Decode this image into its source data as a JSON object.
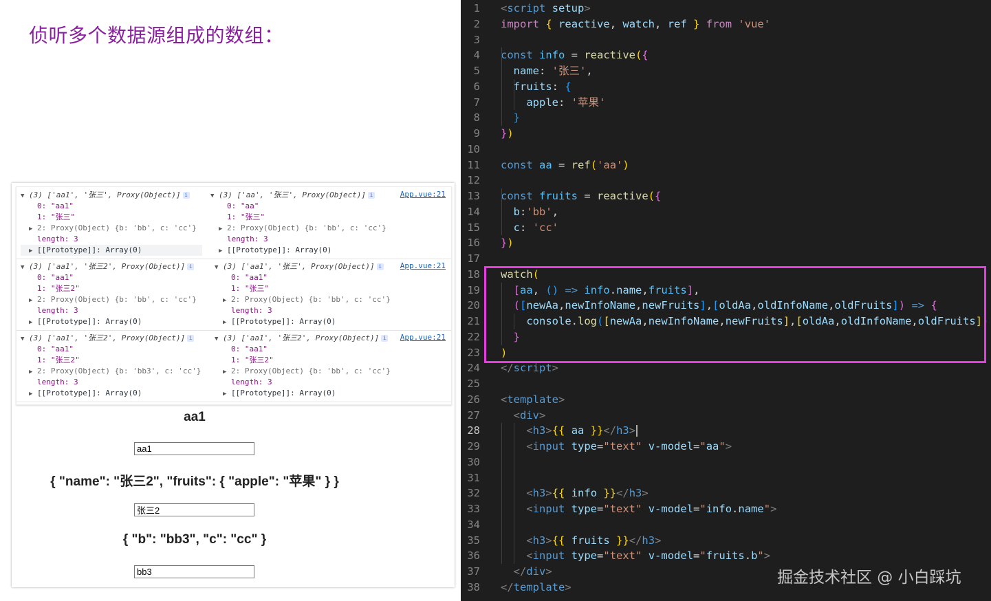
{
  "slide": {
    "title": "侦听多个数据源组成的数组："
  },
  "console": {
    "logs": [
      {
        "source": "App.vue:21",
        "columns": [
          {
            "summary": "(3) ['aa1', '张三', Proxy(Object)]",
            "i0": "0: \"aa1\"",
            "i1": "1: \"张三\"",
            "i2": "2: Proxy(Object) {b: 'bb', c: 'cc'}",
            "length": "length: 3",
            "proto": "[[Prototype]]: Array(0)"
          },
          {
            "summary": "(3) ['aa', '张三', Proxy(Object)]",
            "i0": "0: \"aa\"",
            "i1": "1: \"张三\"",
            "i2": "2: Proxy(Object) {b: 'bb', c: 'cc'}",
            "length": "length: 3",
            "proto": "[[Prototype]]: Array(0)"
          }
        ]
      },
      {
        "source": "App.vue:21",
        "columns": [
          {
            "summary": "(3) ['aa1', '张三2', Proxy(Object)]",
            "i0": "0: \"aa1\"",
            "i1": "1: \"张三2\"",
            "i2": "2: Proxy(Object) {b: 'bb', c: 'cc'}",
            "length": "length: 3",
            "proto": "[[Prototype]]: Array(0)"
          },
          {
            "summary": "(3) ['aa1', '张三', Proxy(Object)]",
            "i0": "0: \"aa1\"",
            "i1": "1: \"张三\"",
            "i2": "2: Proxy(Object) {b: 'bb', c: 'cc'}",
            "length": "length: 3",
            "proto": "[[Prototype]]: Array(0)"
          }
        ]
      },
      {
        "source": "App.vue:21",
        "columns": [
          {
            "summary": "(3) ['aa1', '张三2', Proxy(Object)]",
            "i0": "0: \"aa1\"",
            "i1": "1: \"张三2\"",
            "i2": "2: Proxy(Object) {b: 'bb3', c: 'cc'}",
            "length": "length: 3",
            "proto": "[[Prototype]]: Array(0)"
          },
          {
            "summary": "(3) ['aa1', '张三2', Proxy(Object)]",
            "i0": "0: \"aa1\"",
            "i1": "1: \"张三2\"",
            "i2": "2: Proxy(Object) {b: 'bb', c: 'cc'}",
            "length": "length: 3",
            "proto": "[[Prototype]]: Array(0)"
          }
        ]
      }
    ]
  },
  "preview": {
    "h3_aa": "aa1",
    "input_aa": "aa1",
    "h3_info": "{ \"name\": \"张三2\", \"fruits\": { \"apple\": \"苹果\" } }",
    "input_info": "张三2",
    "h3_fruits": "{ \"b\": \"bb3\", \"c\": \"cc\" }",
    "input_fruits": "bb3"
  },
  "editor": {
    "active_line": 28,
    "lines": [
      [
        [
          "tg",
          "<"
        ],
        [
          "kw",
          "script"
        ],
        [
          "pl",
          " "
        ],
        [
          "prop",
          "setup"
        ],
        [
          "tg",
          ">"
        ]
      ],
      [
        [
          "cd",
          "import"
        ],
        [
          "pl",
          " "
        ],
        [
          "br1",
          "{"
        ],
        [
          "pl",
          " "
        ],
        [
          "prop",
          "reactive"
        ],
        [
          "pl",
          ", "
        ],
        [
          "prop",
          "watch"
        ],
        [
          "pl",
          ", "
        ],
        [
          "prop",
          "ref"
        ],
        [
          "pl",
          " "
        ],
        [
          "br1",
          "}"
        ],
        [
          "pl",
          " "
        ],
        [
          "cd",
          "from"
        ],
        [
          "pl",
          " "
        ],
        [
          "str",
          "'vue'"
        ]
      ],
      [],
      [
        [
          "kw",
          "const"
        ],
        [
          "pl",
          " "
        ],
        [
          "var",
          "info"
        ],
        [
          "pl",
          " = "
        ],
        [
          "fn",
          "reactive"
        ],
        [
          "br1",
          "("
        ],
        [
          "br2",
          "{"
        ]
      ],
      [
        [
          "pl",
          "  "
        ],
        [
          "prop",
          "name"
        ],
        [
          "pl",
          ": "
        ],
        [
          "str",
          "'张三'"
        ],
        [
          "pl",
          ","
        ]
      ],
      [
        [
          "pl",
          "  "
        ],
        [
          "prop",
          "fruits"
        ],
        [
          "pl",
          ": "
        ],
        [
          "br3",
          "{"
        ]
      ],
      [
        [
          "pl",
          "    "
        ],
        [
          "prop",
          "apple"
        ],
        [
          "pl",
          ": "
        ],
        [
          "str",
          "'苹果'"
        ]
      ],
      [
        [
          "pl",
          "  "
        ],
        [
          "br3",
          "}"
        ]
      ],
      [
        [
          "br2",
          "}"
        ],
        [
          "br1",
          ")"
        ]
      ],
      [],
      [
        [
          "kw",
          "const"
        ],
        [
          "pl",
          " "
        ],
        [
          "var",
          "aa"
        ],
        [
          "pl",
          " = "
        ],
        [
          "fn",
          "ref"
        ],
        [
          "br1",
          "("
        ],
        [
          "str",
          "'aa'"
        ],
        [
          "br1",
          ")"
        ]
      ],
      [],
      [
        [
          "kw",
          "const"
        ],
        [
          "pl",
          " "
        ],
        [
          "var",
          "fruits"
        ],
        [
          "pl",
          " = "
        ],
        [
          "fn",
          "reactive"
        ],
        [
          "br1",
          "("
        ],
        [
          "br2",
          "{"
        ]
      ],
      [
        [
          "pl",
          "  "
        ],
        [
          "prop",
          "b"
        ],
        [
          "pl",
          ":"
        ],
        [
          "str",
          "'bb'"
        ],
        [
          "pl",
          ","
        ]
      ],
      [
        [
          "pl",
          "  "
        ],
        [
          "prop",
          "c"
        ],
        [
          "pl",
          ": "
        ],
        [
          "str",
          "'cc'"
        ]
      ],
      [
        [
          "br2",
          "}"
        ],
        [
          "br1",
          ")"
        ]
      ],
      [],
      [
        [
          "fn",
          "watch"
        ],
        [
          "br1",
          "("
        ]
      ],
      [
        [
          "pl",
          "  "
        ],
        [
          "br2",
          "["
        ],
        [
          "var",
          "aa"
        ],
        [
          "pl",
          ", "
        ],
        [
          "br3",
          "()"
        ],
        [
          "pl",
          " "
        ],
        [
          "kw",
          "=>"
        ],
        [
          "pl",
          " "
        ],
        [
          "var",
          "info"
        ],
        [
          "pl",
          "."
        ],
        [
          "prop",
          "name"
        ],
        [
          "pl",
          ","
        ],
        [
          "var",
          "fruits"
        ],
        [
          "br2",
          "]"
        ],
        [
          "pl",
          ","
        ]
      ],
      [
        [
          "pl",
          "  "
        ],
        [
          "br2",
          "("
        ],
        [
          "br3",
          "["
        ],
        [
          "prop",
          "newAa"
        ],
        [
          "pl",
          ","
        ],
        [
          "prop",
          "newInfoName"
        ],
        [
          "pl",
          ","
        ],
        [
          "prop",
          "newFruits"
        ],
        [
          "br3",
          "]"
        ],
        [
          "pl",
          ","
        ],
        [
          "br3",
          "["
        ],
        [
          "prop",
          "oldAa"
        ],
        [
          "pl",
          ","
        ],
        [
          "prop",
          "oldInfoName"
        ],
        [
          "pl",
          ","
        ],
        [
          "prop",
          "oldFruits"
        ],
        [
          "br3",
          "]"
        ],
        [
          "br2",
          ")"
        ],
        [
          "pl",
          " "
        ],
        [
          "kw",
          "=>"
        ],
        [
          "pl",
          " "
        ],
        [
          "br2",
          "{"
        ]
      ],
      [
        [
          "pl",
          "    "
        ],
        [
          "prop",
          "console"
        ],
        [
          "pl",
          "."
        ],
        [
          "fn",
          "log"
        ],
        [
          "br3",
          "("
        ],
        [
          "br1",
          "["
        ],
        [
          "prop",
          "newAa"
        ],
        [
          "pl",
          ","
        ],
        [
          "prop",
          "newInfoName"
        ],
        [
          "pl",
          ","
        ],
        [
          "prop",
          "newFruits"
        ],
        [
          "br1",
          "]"
        ],
        [
          "pl",
          ","
        ],
        [
          "br1",
          "["
        ],
        [
          "prop",
          "oldAa"
        ],
        [
          "pl",
          ","
        ],
        [
          "prop",
          "oldInfoName"
        ],
        [
          "pl",
          ","
        ],
        [
          "prop",
          "oldFruits"
        ],
        [
          "br1",
          "]"
        ],
        [
          "br3",
          ")"
        ]
      ],
      [
        [
          "pl",
          "  "
        ],
        [
          "br2",
          "}"
        ]
      ],
      [
        [
          "br1",
          ")"
        ]
      ],
      [
        [
          "tg",
          "</"
        ],
        [
          "kw",
          "script"
        ],
        [
          "tg",
          ">"
        ]
      ],
      [],
      [
        [
          "tg",
          "<"
        ],
        [
          "kw",
          "template"
        ],
        [
          "tg",
          ">"
        ]
      ],
      [
        [
          "pl",
          "  "
        ],
        [
          "tg",
          "<"
        ],
        [
          "kw",
          "div"
        ],
        [
          "tg",
          ">"
        ]
      ],
      [
        [
          "pl",
          "    "
        ],
        [
          "tg",
          "<"
        ],
        [
          "kw",
          "h3"
        ],
        [
          "tg",
          ">"
        ],
        [
          "br1",
          "{{"
        ],
        [
          "pl",
          " "
        ],
        [
          "prop",
          "aa"
        ],
        [
          "pl",
          " "
        ],
        [
          "br1",
          "}}"
        ],
        [
          "tg",
          "</"
        ],
        [
          "kw",
          "h3"
        ],
        [
          "tg",
          ">"
        ]
      ],
      [
        [
          "pl",
          "    "
        ],
        [
          "tg",
          "<"
        ],
        [
          "kw",
          "input"
        ],
        [
          "pl",
          " "
        ],
        [
          "attr",
          "type"
        ],
        [
          "pl",
          "="
        ],
        [
          "str",
          "\"text\""
        ],
        [
          "pl",
          " "
        ],
        [
          "attr",
          "v-model"
        ],
        [
          "pl",
          "="
        ],
        [
          "str",
          "\""
        ],
        [
          "prop",
          "aa"
        ],
        [
          "str",
          "\""
        ],
        [
          "tg",
          ">"
        ]
      ],
      [],
      [],
      [
        [
          "pl",
          "    "
        ],
        [
          "tg",
          "<"
        ],
        [
          "kw",
          "h3"
        ],
        [
          "tg",
          ">"
        ],
        [
          "br1",
          "{{"
        ],
        [
          "pl",
          " "
        ],
        [
          "prop",
          "info"
        ],
        [
          "pl",
          " "
        ],
        [
          "br1",
          "}}"
        ],
        [
          "tg",
          "</"
        ],
        [
          "kw",
          "h3"
        ],
        [
          "tg",
          ">"
        ]
      ],
      [
        [
          "pl",
          "    "
        ],
        [
          "tg",
          "<"
        ],
        [
          "kw",
          "input"
        ],
        [
          "pl",
          " "
        ],
        [
          "attr",
          "type"
        ],
        [
          "pl",
          "="
        ],
        [
          "str",
          "\"text\""
        ],
        [
          "pl",
          " "
        ],
        [
          "attr",
          "v-model"
        ],
        [
          "pl",
          "="
        ],
        [
          "str",
          "\""
        ],
        [
          "prop",
          "info"
        ],
        [
          "pl",
          "."
        ],
        [
          "prop",
          "name"
        ],
        [
          "str",
          "\""
        ],
        [
          "tg",
          ">"
        ]
      ],
      [],
      [
        [
          "pl",
          "    "
        ],
        [
          "tg",
          "<"
        ],
        [
          "kw",
          "h3"
        ],
        [
          "tg",
          ">"
        ],
        [
          "br1",
          "{{"
        ],
        [
          "pl",
          " "
        ],
        [
          "prop",
          "fruits"
        ],
        [
          "pl",
          " "
        ],
        [
          "br1",
          "}}"
        ],
        [
          "tg",
          "</"
        ],
        [
          "kw",
          "h3"
        ],
        [
          "tg",
          ">"
        ]
      ],
      [
        [
          "pl",
          "    "
        ],
        [
          "tg",
          "<"
        ],
        [
          "kw",
          "input"
        ],
        [
          "pl",
          " "
        ],
        [
          "attr",
          "type"
        ],
        [
          "pl",
          "="
        ],
        [
          "str",
          "\"text\""
        ],
        [
          "pl",
          " "
        ],
        [
          "attr",
          "v-model"
        ],
        [
          "pl",
          "="
        ],
        [
          "str",
          "\""
        ],
        [
          "prop",
          "fruits"
        ],
        [
          "pl",
          "."
        ],
        [
          "prop",
          "b"
        ],
        [
          "str",
          "\""
        ],
        [
          "tg",
          ">"
        ]
      ],
      [
        [
          "pl",
          "  "
        ],
        [
          "tg",
          "</"
        ],
        [
          "kw",
          "div"
        ],
        [
          "tg",
          ">"
        ]
      ],
      [
        [
          "tg",
          "</"
        ],
        [
          "kw",
          "template"
        ],
        [
          "tg",
          ">"
        ]
      ]
    ]
  },
  "watermark": "掘金技术社区 @ 小白踩坑"
}
